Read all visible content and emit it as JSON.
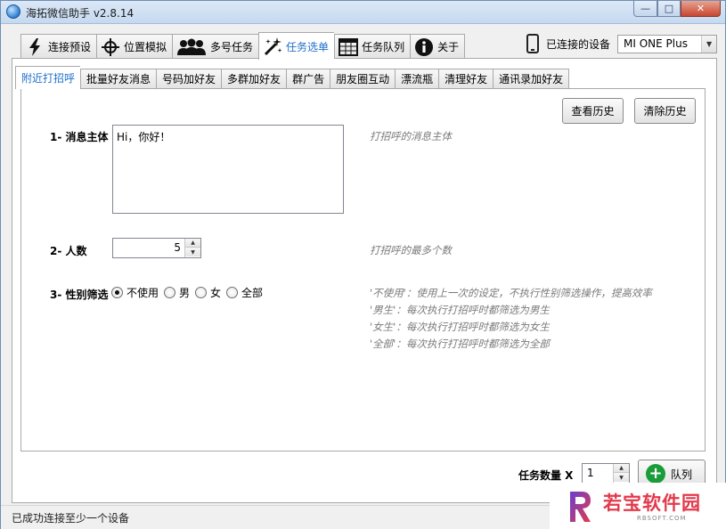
{
  "window": {
    "title": "海拓微信助手 v2.8.14",
    "controls": {
      "minimize": "—",
      "maximize": "□",
      "close": "✕"
    }
  },
  "main_tabs": [
    {
      "label": "连接预设",
      "icon": "lightning-icon"
    },
    {
      "label": "位置模拟",
      "icon": "crosshair-icon"
    },
    {
      "label": "多号任务",
      "icon": "users-icon"
    },
    {
      "label": "任务选单",
      "icon": "magic-wand-icon",
      "active": true
    },
    {
      "label": "任务队列",
      "icon": "table-icon"
    },
    {
      "label": "关于",
      "icon": "info-icon"
    }
  ],
  "device": {
    "label": "已连接的设备",
    "selected": "MI ONE Plus"
  },
  "sub_tabs": [
    {
      "label": "附近打招呼",
      "active": true
    },
    {
      "label": "批量好友消息"
    },
    {
      "label": "号码加好友"
    },
    {
      "label": "多群加好友"
    },
    {
      "label": "群广告"
    },
    {
      "label": "朋友圈互动"
    },
    {
      "label": "漂流瓶"
    },
    {
      "label": "清理好友"
    },
    {
      "label": "通讯录加好友"
    }
  ],
  "buttons": {
    "view_history": "查看历史",
    "clear_history": "清除历史",
    "queue": "队列"
  },
  "form": {
    "message": {
      "label": "1- 消息主体",
      "value": "Hi，你好！",
      "hint": "打招呼的消息主体"
    },
    "count": {
      "label": "2- 人数",
      "value": "5",
      "hint": "打招呼的最多个数"
    },
    "gender": {
      "label": "3- 性别筛选",
      "options": [
        "不使用",
        "男",
        "女",
        "全部"
      ],
      "selected": "不使用",
      "hints": [
        "'不使用'：使用上一次的设定，不执行性别筛选操作，提高效率",
        "'男生'：每次执行打招呼时都筛选为男生",
        "'女生'：每次执行打招呼时都筛选为女生",
        "'全部'：每次执行打招呼时都筛选为全部"
      ]
    }
  },
  "task_count": {
    "label": "任务数量 X",
    "value": "1"
  },
  "status": {
    "text": "已成功连接至少一个设备"
  },
  "watermark": {
    "text": "若宝软件园",
    "sub": "RBSOFT.COM"
  },
  "colors": {
    "accent_blue": "#1e6fcd",
    "queue_green": "#1a9c3a",
    "watermark_red": "#e23a4c",
    "watermark_purple": "#6a3fd0"
  }
}
